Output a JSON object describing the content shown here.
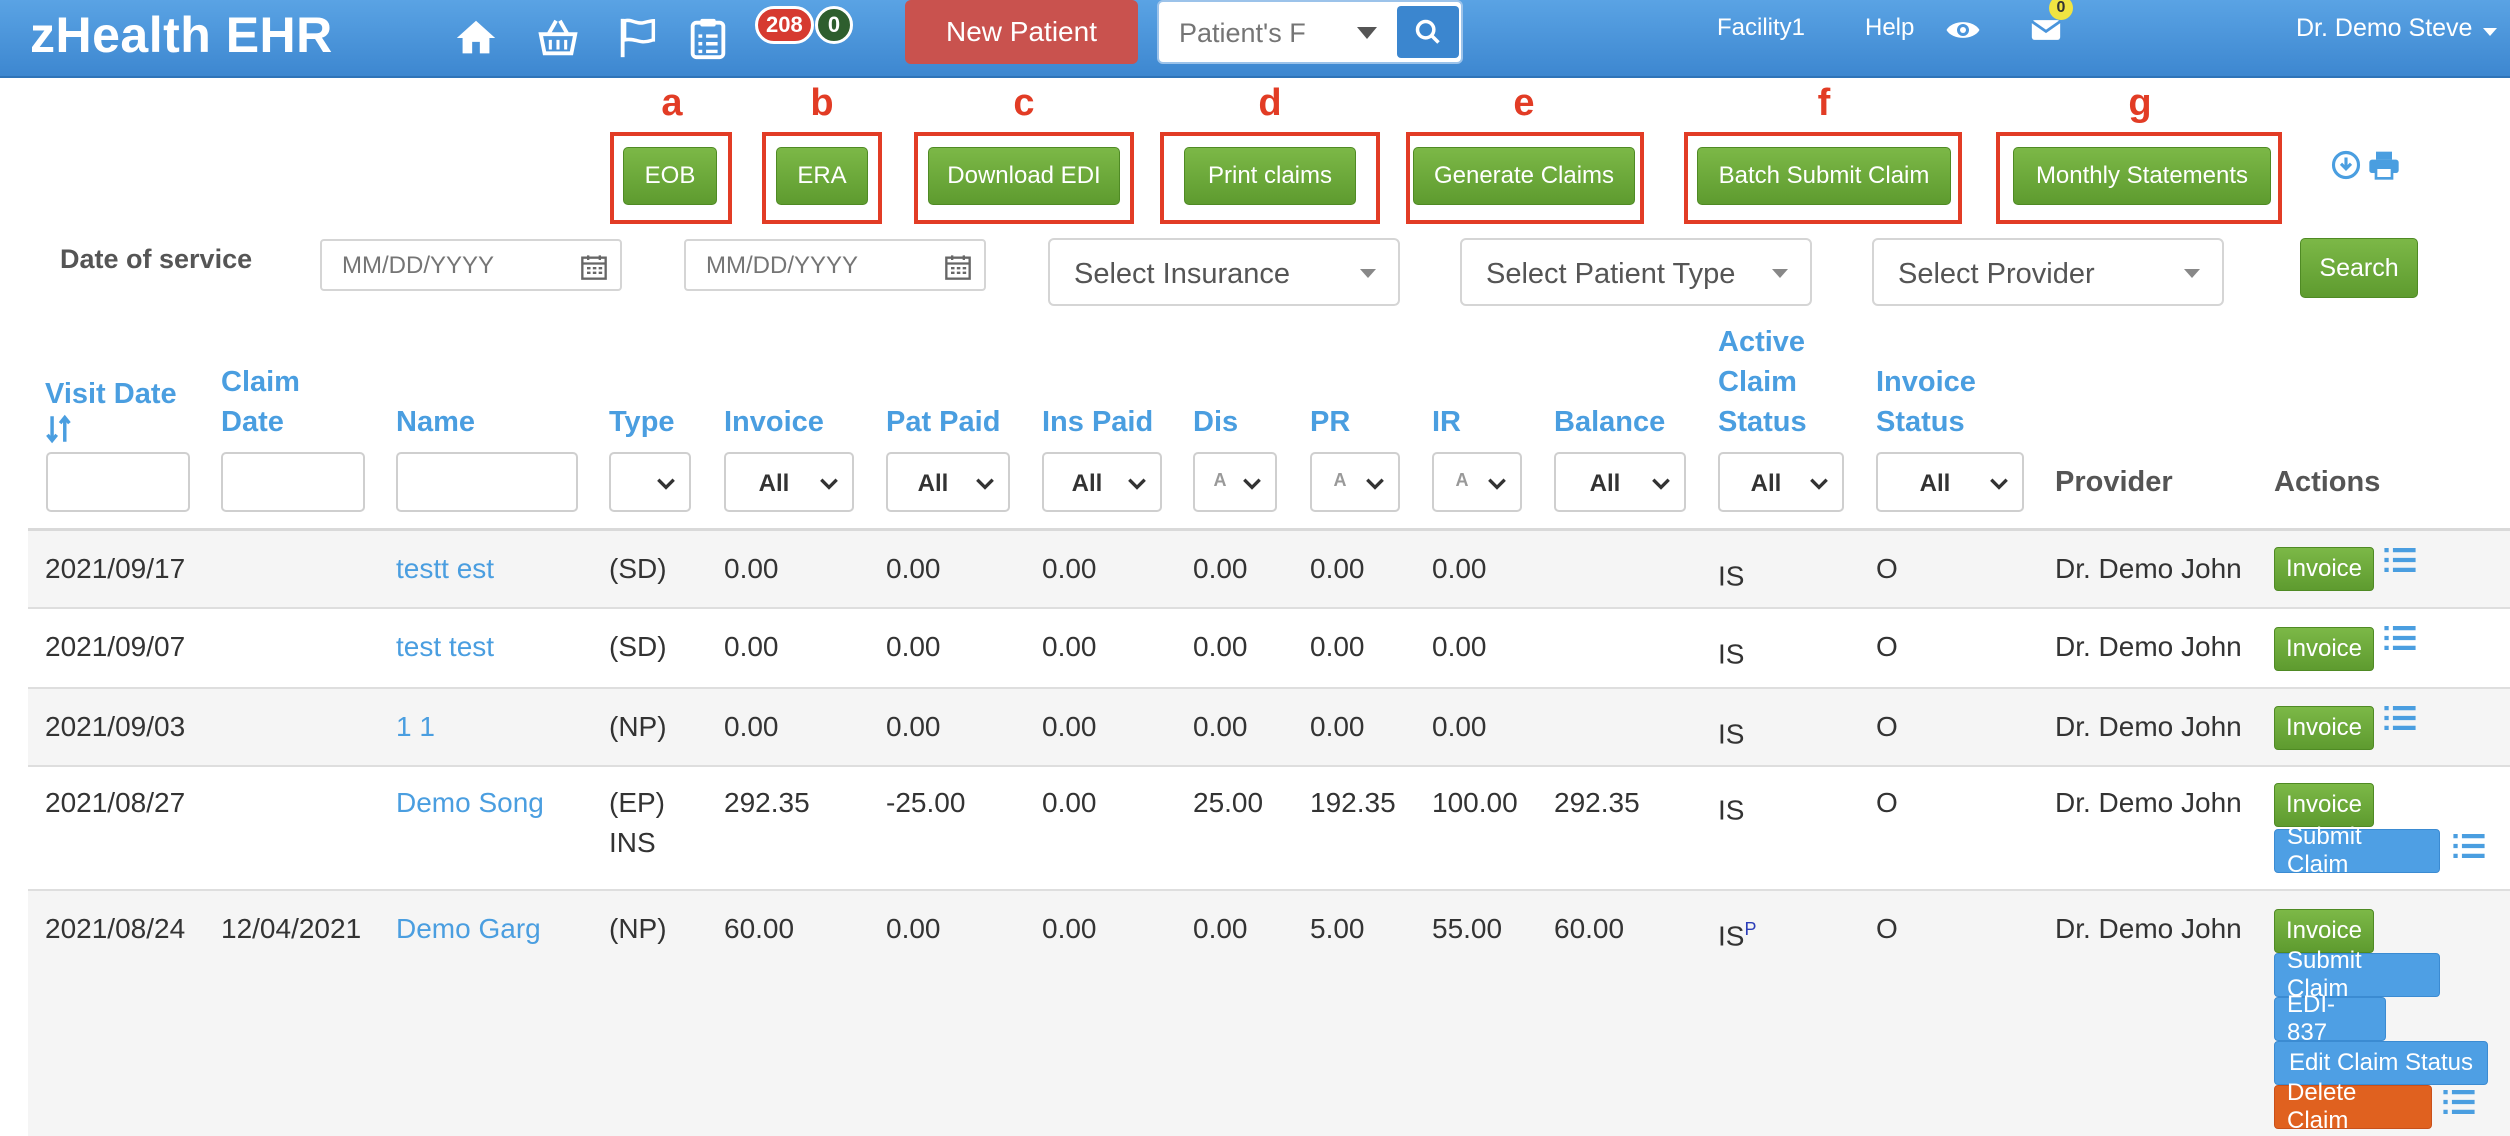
{
  "app": {
    "brand": "zHealth EHR"
  },
  "nav": {
    "badge_red": "208",
    "badge_dark": "0",
    "new_patient": "New Patient",
    "search_placeholder": "Patient's F",
    "facility": "Facility1",
    "help": "Help",
    "mail_count": "0",
    "user": "Dr. Demo Steve"
  },
  "toolbar": {
    "buttons": [
      {
        "letter": "a",
        "label": "EOB"
      },
      {
        "letter": "b",
        "label": "ERA"
      },
      {
        "letter": "c",
        "label": "Download EDI"
      },
      {
        "letter": "d",
        "label": "Print claims"
      },
      {
        "letter": "e",
        "label": "Generate Claims"
      },
      {
        "letter": "f",
        "label": "Batch Submit Claim"
      },
      {
        "letter": "g",
        "label": "Monthly Statements"
      }
    ]
  },
  "filters": {
    "date_label": "Date of service",
    "date_placeholder": "MM/DD/YYYY",
    "insurance": "Select Insurance",
    "patient_type": "Select Patient Type",
    "provider": "Select Provider",
    "search": "Search"
  },
  "table": {
    "headers": {
      "visit_date": "Visit Date",
      "claim_date_1": "Claim",
      "claim_date_2": "Date",
      "name": "Name",
      "type": "Type",
      "invoice": "Invoice",
      "pat_paid": "Pat Paid",
      "ins_paid": "Ins Paid",
      "dis": "Dis",
      "pr": "PR",
      "ir": "IR",
      "balance": "Balance",
      "acs_1": "Active",
      "acs_2": "Claim",
      "acs_3": "Status",
      "inv_status_1": "Invoice",
      "inv_status_2": "Status",
      "provider": "Provider",
      "actions": "Actions"
    },
    "filter_values": {
      "all": "All",
      "narrow": "A"
    },
    "rows": [
      {
        "visit": "2021/09/17",
        "claim": "",
        "name": "testt est",
        "type": "(SD)",
        "type2": "",
        "invoice": "0.00",
        "pat_paid": "0.00",
        "ins_paid": "0.00",
        "dis": "0.00",
        "pr": "0.00",
        "ir": "0.00",
        "balance": "",
        "acs": "IS",
        "acs_sup": "",
        "inv_status": "O",
        "provider": "Dr. Demo John"
      },
      {
        "visit": "2021/09/07",
        "claim": "",
        "name": "test test",
        "type": "(SD)",
        "type2": "",
        "invoice": "0.00",
        "pat_paid": "0.00",
        "ins_paid": "0.00",
        "dis": "0.00",
        "pr": "0.00",
        "ir": "0.00",
        "balance": "",
        "acs": "IS",
        "acs_sup": "",
        "inv_status": "O",
        "provider": "Dr. Demo John"
      },
      {
        "visit": "2021/09/03",
        "claim": "",
        "name": "1 1",
        "type": "(NP)",
        "type2": "",
        "invoice": "0.00",
        "pat_paid": "0.00",
        "ins_paid": "0.00",
        "dis": "0.00",
        "pr": "0.00",
        "ir": "0.00",
        "balance": "",
        "acs": "IS",
        "acs_sup": "",
        "inv_status": "O",
        "provider": "Dr. Demo John"
      },
      {
        "visit": "2021/08/27",
        "claim": "",
        "name": "Demo Song",
        "type": "(EP)",
        "type2": "INS",
        "invoice": "292.35",
        "pat_paid": "-25.00",
        "ins_paid": "0.00",
        "dis": "25.00",
        "pr": "192.35",
        "ir": "100.00",
        "balance": "292.35",
        "acs": "IS",
        "acs_sup": "",
        "inv_status": "O",
        "provider": "Dr. Demo John"
      },
      {
        "visit": "2021/08/24",
        "claim": "12/04/2021",
        "name": "Demo Garg",
        "type": "(NP)",
        "type2": "",
        "invoice": "60.00",
        "pat_paid": "0.00",
        "ins_paid": "0.00",
        "dis": "0.00",
        "pr": "5.00",
        "ir": "55.00",
        "balance": "60.00",
        "acs": "IS",
        "acs_sup": "P",
        "inv_status": "O",
        "provider": "Dr. Demo John"
      }
    ],
    "actions": {
      "invoice": "Invoice",
      "submit_claim": "Submit Claim",
      "edi": "EDI-837",
      "edit_claim_status": "Edit Claim Status",
      "delete_claim": "Delete Claim"
    }
  },
  "colors": {
    "navbar": "#4a95dc",
    "accent": "#4a9ee0",
    "green": "#6aaa3a",
    "danger": "#c9524e",
    "callout": "#e23c25"
  }
}
